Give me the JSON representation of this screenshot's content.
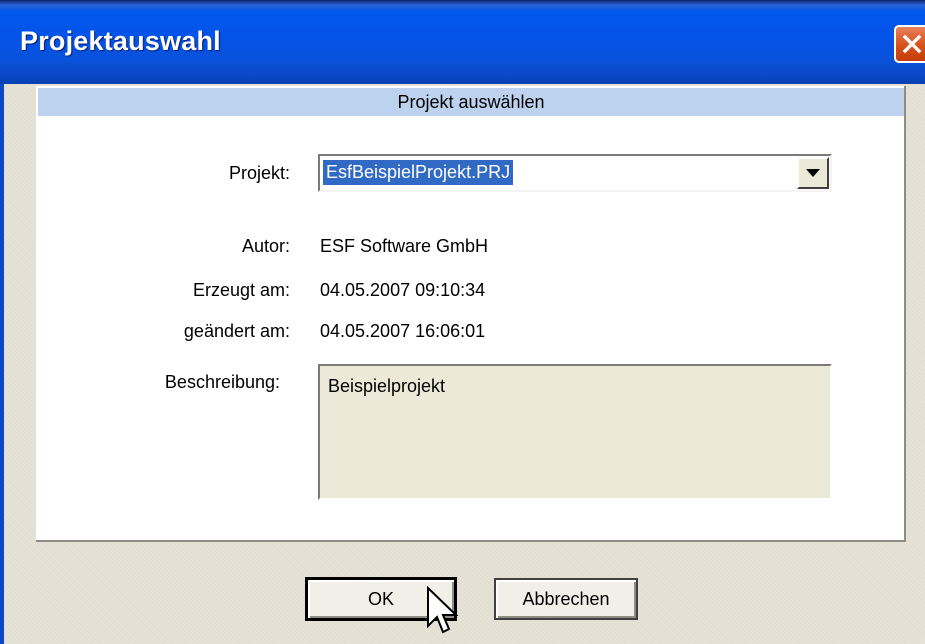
{
  "window": {
    "title": "Projektauswahl"
  },
  "panel": {
    "header": "Projekt auswählen"
  },
  "form": {
    "project_label": "Projekt:",
    "project_value": "EsfBeispielProjekt.PRJ",
    "author_label": "Autor:",
    "author_value": "ESF Software GmbH",
    "created_label": "Erzeugt am:",
    "created_value": "04.05.2007 09:10:34",
    "modified_label": "geändert am:",
    "modified_value": "04.05.2007 16:06:01",
    "description_label": "Beschreibung:",
    "description_value": "Beispielprojekt"
  },
  "buttons": {
    "ok_label": "OK",
    "cancel_label": "Abbrechen"
  },
  "icons": {
    "close": "close-icon",
    "dropdown": "chevron-down-icon",
    "cursor": "mouse-pointer-icon"
  },
  "colors": {
    "titlebar": "#0553e8",
    "close_button": "#d9541d",
    "panel_header": "#bcd2ee",
    "selection": "#316ac5"
  }
}
